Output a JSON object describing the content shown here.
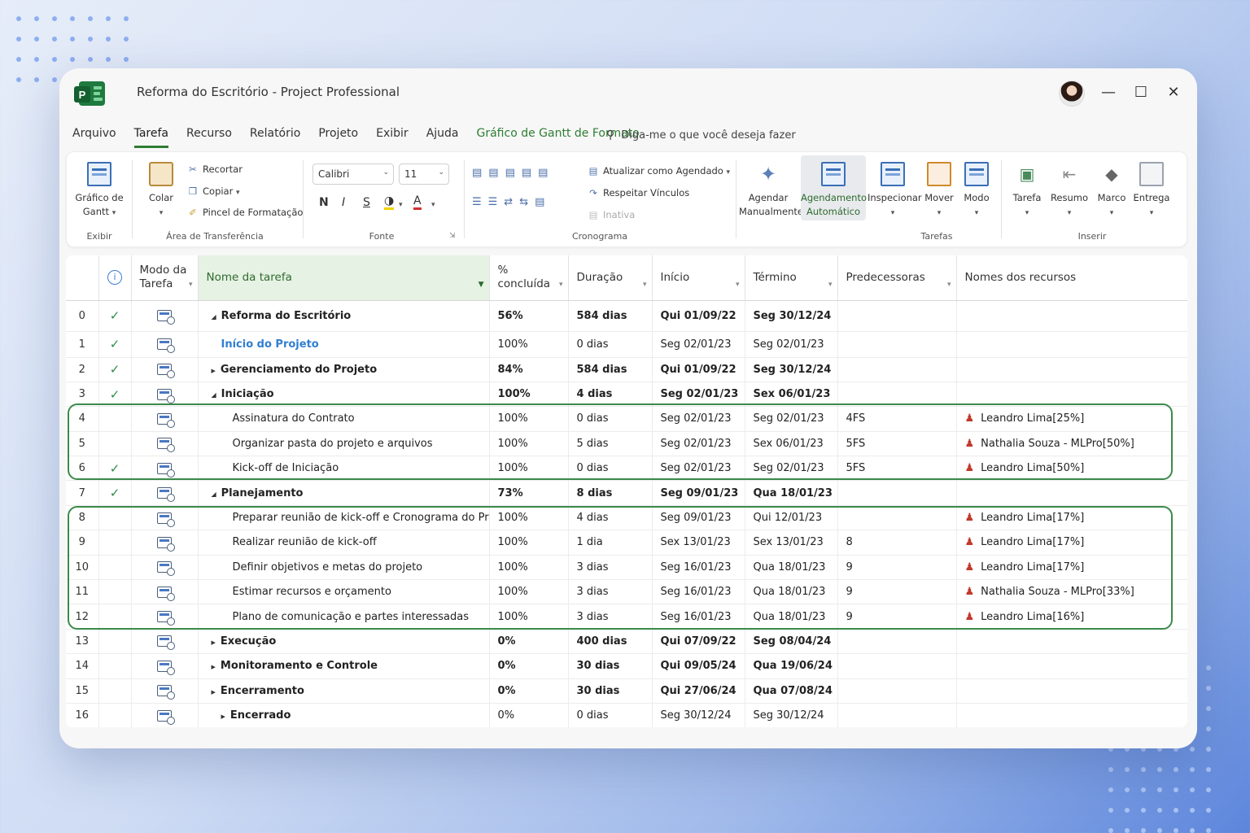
{
  "window": {
    "title": "Reforma do Escritório - Project Professional"
  },
  "menu": {
    "items": [
      "Arquivo",
      "Tarefa",
      "Recurso",
      "Relatório",
      "Projeto",
      "Exibir",
      "Ajuda",
      "Gráfico de Gantt de Formato"
    ],
    "active": "Tarefa",
    "tellme": "Diga-me o que você deseja fazer"
  },
  "ribbon": {
    "exibir": {
      "button": "Gráfico de Gantt",
      "group": "Exibir"
    },
    "clipboard": {
      "paste": "Colar",
      "cut": "Recortar",
      "copy": "Copiar",
      "painter": "Pincel de Formatação",
      "group": "Área de Transferência"
    },
    "font": {
      "name": "Calibri",
      "size": "11",
      "bold": "N",
      "italic": "I",
      "underline": "S",
      "color_letter": "A",
      "group": "Fonte"
    },
    "cronograma": {
      "update": "Atualizar como Agendado",
      "respect": "Respeitar Vínculos",
      "inactive": "Inativa",
      "group": "Cronograma"
    },
    "tarefas": {
      "manual": "Agendar Manualmente",
      "auto": "Agendamento Automático",
      "inspect": "Inspecionar",
      "move": "Mover",
      "mode": "Modo",
      "group": "Tarefas"
    },
    "inserir": {
      "task": "Tarefa",
      "summary": "Resumo",
      "milestone": "Marco",
      "deliverable": "Entrega",
      "group": "Inserir"
    }
  },
  "table": {
    "headers": {
      "mode": "Modo da Tarefa",
      "name": "Nome da tarefa",
      "pct": "% concluída",
      "duration": "Duração",
      "start": "Início",
      "finish": "Término",
      "pred": "Predecessoras",
      "resources": "Nomes dos recursos"
    },
    "rows": [
      {
        "id": "0",
        "check": "✓",
        "name": "Reforma do Escritório",
        "pct": "56%",
        "duration": "584 dias",
        "start": "Qui 01/09/22",
        "finish": "Seg 30/12/24",
        "pred": "",
        "resource": ""
      },
      {
        "id": "1",
        "check": "✓",
        "name": "Início do Projeto",
        "pct": "100%",
        "duration": "0 dias",
        "start": "Seg 02/01/23",
        "finish": "Seg 02/01/23",
        "pred": "",
        "resource": ""
      },
      {
        "id": "2",
        "check": "✓",
        "name": "Gerenciamento do Projeto",
        "pct": "84%",
        "duration": "584 dias",
        "start": "Qui 01/09/22",
        "finish": "Seg 30/12/24",
        "pred": "",
        "resource": ""
      },
      {
        "id": "3",
        "check": "✓",
        "name": "Iniciação",
        "pct": "100%",
        "duration": "4 dias",
        "start": "Seg 02/01/23",
        "finish": "Sex 06/01/23",
        "pred": "",
        "resource": ""
      },
      {
        "id": "4",
        "check": "",
        "name": "Assinatura do Contrato",
        "pct": "100%",
        "duration": "0 dias",
        "start": "Seg 02/01/23",
        "finish": "Seg 02/01/23",
        "pred": "4FS",
        "resource": "Leandro Lima[25%]"
      },
      {
        "id": "5",
        "check": "",
        "name": "Organizar pasta do projeto e arquivos",
        "pct": "100%",
        "duration": "5 dias",
        "start": "Seg 02/01/23",
        "finish": "Sex 06/01/23",
        "pred": "5FS",
        "resource": "Nathalia Souza - MLPro[50%]"
      },
      {
        "id": "6",
        "check": "✓",
        "name": "Kick-off de Iniciação",
        "pct": "100%",
        "duration": "0 dias",
        "start": "Seg 02/01/23",
        "finish": "Seg 02/01/23",
        "pred": "5FS",
        "resource": "Leandro Lima[50%]"
      },
      {
        "id": "7",
        "check": "✓",
        "name": "Planejamento",
        "pct": "73%",
        "duration": "8 dias",
        "start": "Seg 09/01/23",
        "finish": "Qua 18/01/23",
        "pred": "",
        "resource": ""
      },
      {
        "id": "8",
        "check": "",
        "name": "Preparar reunião de kick-off e Cronograma do Projeto",
        "pct": "100%",
        "duration": "4 dias",
        "start": "Seg 09/01/23",
        "finish": "Qui 12/01/23",
        "pred": "",
        "resource": "Leandro Lima[17%]"
      },
      {
        "id": "9",
        "check": "",
        "name": "Realizar reunião de kick-off",
        "pct": "100%",
        "duration": "1 dia",
        "start": "Sex 13/01/23",
        "finish": "Sex 13/01/23",
        "pred": "8",
        "resource": "Leandro Lima[17%]"
      },
      {
        "id": "10",
        "check": "",
        "name": "Definir objetivos e metas do projeto",
        "pct": "100%",
        "duration": "3 dias",
        "start": "Seg 16/01/23",
        "finish": "Qua 18/01/23",
        "pred": "9",
        "resource": "Leandro Lima[17%]"
      },
      {
        "id": "11",
        "check": "",
        "name": "Estimar recursos e orçamento",
        "pct": "100%",
        "duration": "3 dias",
        "start": "Seg 16/01/23",
        "finish": "Qua 18/01/23",
        "pred": "9",
        "resource": "Nathalia Souza - MLPro[33%]"
      },
      {
        "id": "12",
        "check": "",
        "name": "Plano de comunicação e partes interessadas",
        "pct": "100%",
        "duration": "3 dias",
        "start": "Seg 16/01/23",
        "finish": "Qua 18/01/23",
        "pred": "9",
        "resource": "Leandro Lima[16%]"
      },
      {
        "id": "13",
        "check": "",
        "name": "Execução",
        "pct": "0%",
        "duration": "400 dias",
        "start": "Qui 07/09/22",
        "finish": "Seg 08/04/24",
        "pred": "",
        "resource": ""
      },
      {
        "id": "14",
        "check": "",
        "name": "Monitoramento e Controle",
        "pct": "0%",
        "duration": "30 dias",
        "start": "Qui 09/05/24",
        "finish": "Qua 19/06/24",
        "pred": "",
        "resource": ""
      },
      {
        "id": "15",
        "check": "",
        "name": "Encerramento",
        "pct": "0%",
        "duration": "30 dias",
        "start": "Qui 27/06/24",
        "finish": "Qua 07/08/24",
        "pred": "",
        "resource": ""
      },
      {
        "id": "16",
        "check": "",
        "name": "Encerrado",
        "pct": "0%",
        "duration": "0 dias",
        "start": "Seg 30/12/24",
        "finish": "Seg 30/12/24",
        "pred": "",
        "resource": ""
      }
    ]
  },
  "colors": {
    "accent": "#2e7d32",
    "highlight_box": "#3a8a4a",
    "milestone_text": "#2f7ed0",
    "check": "#2e8b4a"
  }
}
